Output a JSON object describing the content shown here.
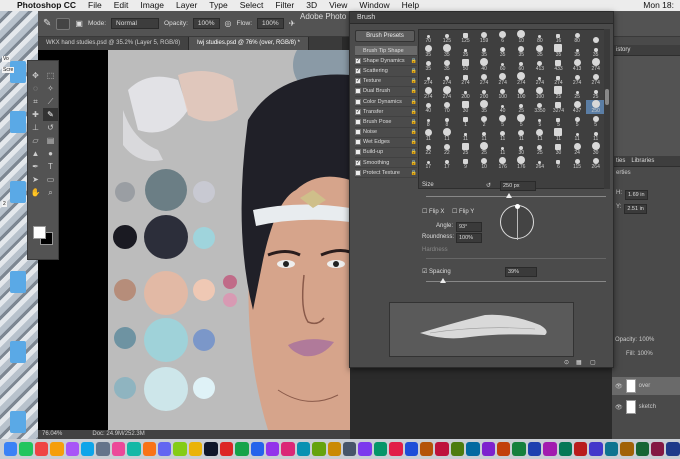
{
  "menubar": {
    "apple": "",
    "app_name": "Photoshop CC",
    "menus": [
      "File",
      "Edit",
      "Image",
      "Layer",
      "Type",
      "Select",
      "Filter",
      "3D",
      "View",
      "Window",
      "Help"
    ],
    "clock": "Mon 18:"
  },
  "window": {
    "title": "Adobe Photo"
  },
  "options_bar": {
    "mode_label": "Mode:",
    "mode_value": "Normal",
    "opacity_label": "Opacity:",
    "opacity_value": "100%",
    "flow_label": "Flow:",
    "flow_value": "100%"
  },
  "tabs": [
    {
      "label": "WKX hand studies.psd @ 35.2% (Layer 5, RGB/8)"
    },
    {
      "label": "lwj studies.psd @ 76% (over, RGB/8) *"
    }
  ],
  "status": {
    "zoom": "76.04%",
    "doc": "Doc: 24.9M/252.3M"
  },
  "desktop_labels": [
    "Vo",
    "Scre",
    "2"
  ],
  "brush_panel": {
    "title": "Brush",
    "presets_button": "Brush Presets",
    "options": [
      {
        "label": "Brush Tip Shape",
        "checked": null,
        "lock": false,
        "selected": true
      },
      {
        "label": "Shape Dynamics",
        "checked": true,
        "lock": true
      },
      {
        "label": "Scattering",
        "checked": true,
        "lock": true
      },
      {
        "label": "Texture",
        "checked": true,
        "lock": true
      },
      {
        "label": "Dual Brush",
        "checked": false,
        "lock": true
      },
      {
        "label": "Color Dynamics",
        "checked": false,
        "lock": true
      },
      {
        "label": "Transfer",
        "checked": true,
        "lock": true
      },
      {
        "label": "Brush Pose",
        "checked": false,
        "lock": true
      },
      {
        "label": "Noise",
        "checked": false,
        "lock": true
      },
      {
        "label": "Wet Edges",
        "checked": false,
        "lock": true
      },
      {
        "label": "Build-up",
        "checked": false,
        "lock": true
      },
      {
        "label": "Smoothing",
        "checked": true,
        "lock": true
      },
      {
        "label": "Protect Texture",
        "checked": false,
        "lock": true
      }
    ],
    "tips": [
      "70",
      "125",
      "125",
      "159",
      "6",
      "10",
      "80",
      "16",
      "80",
      "",
      "35",
      "35",
      "35",
      "35",
      "35",
      "35",
      "35",
      "35",
      "35",
      "35",
      "35",
      "35",
      "50",
      "40",
      "60",
      "60",
      "413",
      "433",
      "413",
      "274",
      "274",
      "274",
      "274",
      "274",
      "274",
      "274",
      "274",
      "274",
      "274",
      "274",
      "274",
      "274",
      "200",
      "200",
      "100",
      "100",
      "100",
      "25",
      "25",
      "25",
      "40",
      "70",
      "30",
      "35",
      "40",
      "25",
      "3350",
      "3274",
      "437",
      "250",
      "8",
      "8",
      "1",
      "2",
      "5",
      "5",
      "5",
      "5",
      "5",
      "5",
      "11",
      "11",
      "11",
      "11",
      "11",
      "11",
      "11",
      "11",
      "11",
      "11",
      "22",
      "22",
      "25",
      "25",
      "11",
      "30",
      "25",
      "30",
      "24",
      "30",
      "17",
      "17",
      "9",
      "10",
      "176",
      "176",
      "264",
      "6",
      "115",
      "264"
    ],
    "selected_tip_index": 59,
    "size_label": "Size",
    "size_value": "250 px",
    "flipx_label": "Flip X",
    "flipy_label": "Flip Y",
    "angle_label": "Angle:",
    "angle_value": "93°",
    "roundness_label": "Roundness:",
    "roundness_value": "100%",
    "hardness_label": "Hardness",
    "spacing_label": "Spacing",
    "spacing_checked": true,
    "spacing_value": "39%"
  },
  "right_panels": {
    "history_label": "istory",
    "properties_tab": "ties",
    "libraries_tab": "Libraries",
    "properties_label": "erties",
    "h_label": "H:",
    "h_value": "1.69 in",
    "y_label": "Y:",
    "y_value": "2.51 in",
    "opacity_label": "Opacity:",
    "opacity_value": "100%",
    "fill_label": "Fill:",
    "fill_value": "100%",
    "layers": [
      "over",
      "sketch"
    ]
  },
  "colors": {
    "accent": "#5b7ea5",
    "panel": "#4b4b4b",
    "canvas_bg": "#bcbcbc",
    "skin": "#d6a48b",
    "hair": "#202028"
  }
}
